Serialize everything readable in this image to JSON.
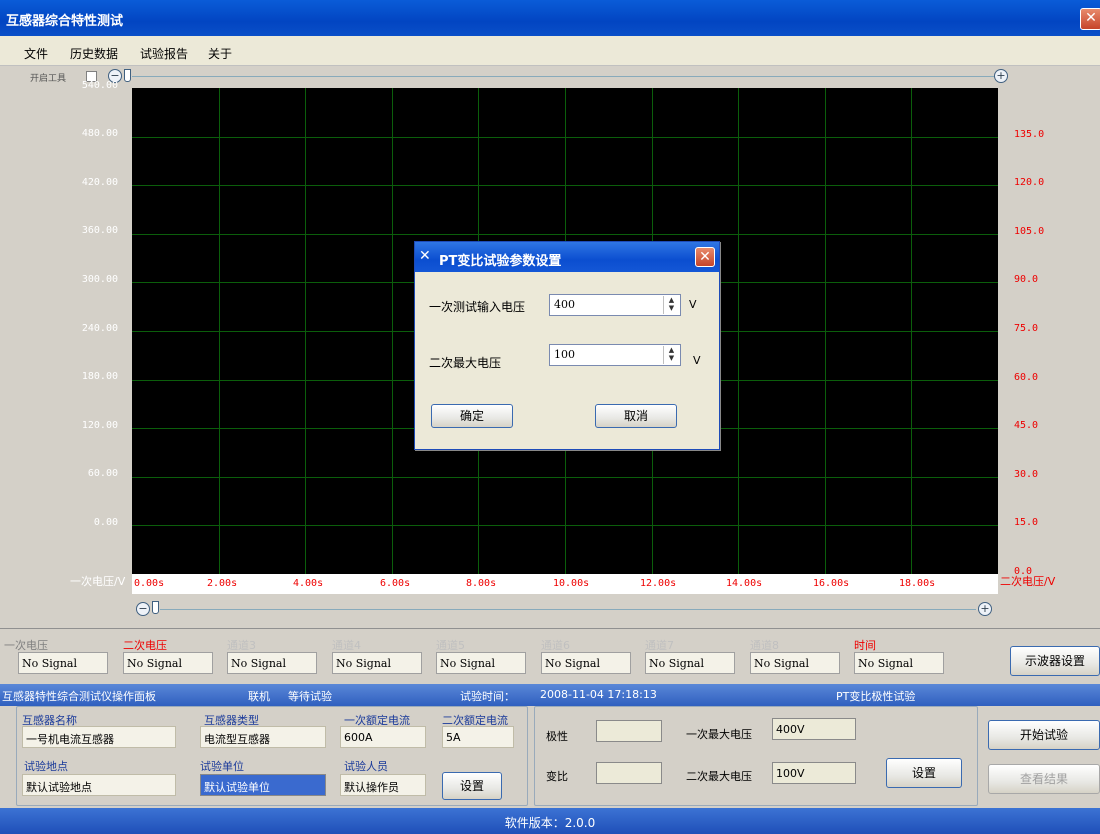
{
  "window": {
    "title": "互感器综合特性测试",
    "close_glyph": "✕"
  },
  "menu": [
    "文件",
    "历史数据",
    "试验报告",
    "关于"
  ],
  "scope_toolbar": {
    "tool_label": "开启工具"
  },
  "chart_data": {
    "type": "line",
    "title": "",
    "xlabel": "",
    "x_ticks": [
      "0.00s",
      "2.00s",
      "4.00s",
      "6.00s",
      "8.00s",
      "10.00s",
      "12.00s",
      "14.00s",
      "16.00s",
      "18.00s"
    ],
    "y_left_label": "一次电压/V",
    "y_left_ticks": [
      "540.00",
      "480.00",
      "420.00",
      "360.00",
      "300.00",
      "240.00",
      "180.00",
      "120.00",
      "60.00",
      "0.00"
    ],
    "y_right_label": "二次电压/V",
    "y_right_ticks": [
      "135.0",
      "120.0",
      "105.0",
      "90.0",
      "75.0",
      "60.0",
      "45.0",
      "30.0",
      "15.0",
      "0.0"
    ],
    "ylim_left": [
      0,
      540
    ],
    "ylim_right": [
      0,
      135
    ],
    "xlim": [
      0,
      20
    ],
    "grid": true,
    "series": []
  },
  "channels": [
    {
      "label": "一次电压",
      "value": "No Signal",
      "style": "gray"
    },
    {
      "label": "二次电压",
      "value": "No Signal",
      "style": "red"
    },
    {
      "label": "通道3",
      "value": "No Signal",
      "style": "fade"
    },
    {
      "label": "通道4",
      "value": "No Signal",
      "style": "fade"
    },
    {
      "label": "通道5",
      "value": "No Signal",
      "style": "fade"
    },
    {
      "label": "通道6",
      "value": "No Signal",
      "style": "fade"
    },
    {
      "label": "通道7",
      "value": "No Signal",
      "style": "fade"
    },
    {
      "label": "通道8",
      "value": "No Signal",
      "style": "fade"
    },
    {
      "label": "时间",
      "value": "No Signal",
      "style": "red"
    }
  ],
  "oscilloscope_settings_button": "示波器设置",
  "status": {
    "panel_name": "互感器特性综合测试仪操作面板",
    "connection": "联机",
    "state": "等待试验",
    "time_label": "试验时间：",
    "time_value": "2008-11-04 17:18:13",
    "test_name": "PT变比极性试验"
  },
  "info": {
    "name_label": "互感器名称",
    "name_value": "一号机电流互感器",
    "type_label": "互感器类型",
    "type_value": "电流型互感器",
    "primary_label": "一次额定电流",
    "primary_value": "600A",
    "secondary_label": "二次额定电流",
    "secondary_value": "5A",
    "site_label": "试验地点",
    "site_value": "默认试验地点",
    "unit_label": "试验单位",
    "unit_value": "默认试验单位",
    "operator_label": "试验人员",
    "operator_value": "默认操作员",
    "setup_button": "设置"
  },
  "results": {
    "polarity_label": "极性",
    "polarity_value": "",
    "ratio_label": "变比",
    "ratio_value": "",
    "primary_max_label": "一次最大电压",
    "primary_max_value": "400V",
    "secondary_max_label": "二次最大电压",
    "secondary_max_value": "100V",
    "setup_button": "设置"
  },
  "actions": {
    "start": "开始试验",
    "view": "查看结果"
  },
  "footer": "软件版本：2.0.0",
  "dialog": {
    "title": "PT变比试验参数设置",
    "primary_label": "一次测试输入电压",
    "primary_value": "400",
    "primary_unit": "V",
    "secondary_label": "二次最大电压",
    "secondary_value": "100",
    "secondary_unit": "V",
    "ok": "确定",
    "cancel": "取消"
  }
}
